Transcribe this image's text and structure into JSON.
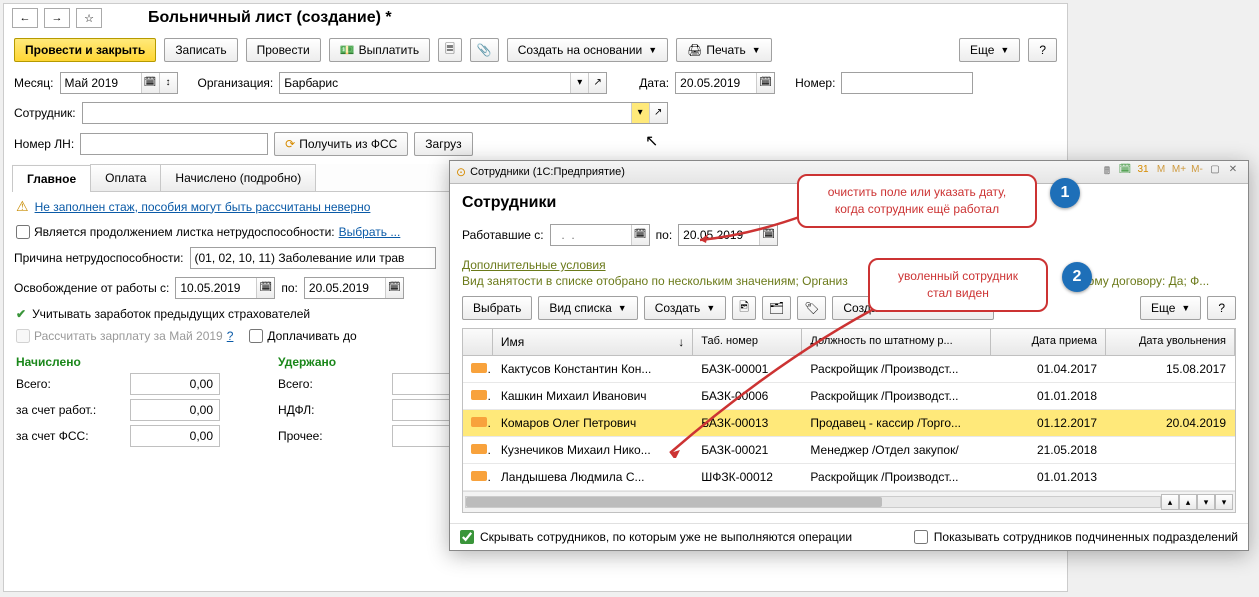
{
  "main": {
    "title": "Больничный лист (создание) *",
    "toolbar": {
      "submit": "Провести и закрыть",
      "save": "Записать",
      "post": "Провести",
      "payout": "Выплатить",
      "base": "Создать на основании",
      "print": "Печать",
      "more": "Еще",
      "help": "?"
    },
    "fields": {
      "month_lbl": "Месяц:",
      "month": "Май 2019",
      "org_lbl": "Организация:",
      "org": "Барбарис",
      "date_lbl": "Дата:",
      "date": "20.05.2019",
      "num_lbl": "Номер:",
      "emp_lbl": "Сотрудник:",
      "ln_lbl": "Номер ЛН:",
      "getfss": "Получить из ФСС",
      "load": "Загруз"
    },
    "tabs": {
      "main": "Главное",
      "pay": "Оплата",
      "acc": "Начислено (подробно)"
    },
    "warn": "Не заполнен стаж, пособия могут быть рассчитаны неверно",
    "cont_lbl": "Является продолжением листка нетрудоспособности:",
    "cont_link": "Выбрать ...",
    "cause_lbl": "Причина нетрудоспособности:",
    "cause_val": "(01, 02, 10, 11) Заболевание или трав",
    "free_lbl": "Освобождение от работы с:",
    "free_from": "10.05.2019",
    "free_to_lbl": "по:",
    "free_to": "20.05.2019",
    "prev_ins": "Учитывать заработок предыдущих страхователей",
    "recalc": "Рассчитать зарплату за Май 2019",
    "extra_lbl": "Доплачивать до",
    "totals": {
      "h1": "Начислено",
      "h2": "Удержано",
      "total_lbl": "Всего:",
      "emp_lbl": "за счет работ.:",
      "fss_lbl": "за счет ФСС:",
      "ndfl_lbl": "НДФЛ:",
      "other_lbl": "Прочее:",
      "zero": "0,00"
    }
  },
  "popup": {
    "title": "Сотрудники (1С:Предприятие)",
    "tb_icons": [
      "M",
      "M+",
      "M-"
    ],
    "h": "Сотрудники",
    "worked_lbl": "Работавшие с:",
    "worked_to_lbl": "по:",
    "worked_to": "20.05.2019",
    "more_cond": "Дополнительные условия",
    "filter_text": "Вид занятости в списке отобрано по нескольким значениям; Организ",
    "filter_text2": "довому договору: Да; Ф...",
    "btns": {
      "pick": "Выбрать",
      "view": "Вид списка",
      "create": "Создать",
      "base": "Создать на основании",
      "more": "Еще",
      "help": "?"
    },
    "cols": {
      "name": "Имя",
      "tab": "Таб. номер",
      "pos": "Должность по штатному р...",
      "hire": "Дата приема",
      "fire": "Дата увольнения"
    },
    "rows": [
      {
        "name": "Кактусов Константин Кон...",
        "tab": "БАЗК-00001",
        "pos": "Раскройщик /Производст...",
        "hire": "01.04.2017",
        "fire": "15.08.2017",
        "sel": false
      },
      {
        "name": "Кашкин Михаил Иванович",
        "tab": "БАЗК-00006",
        "pos": "Раскройщик /Производст...",
        "hire": "01.01.2018",
        "fire": "",
        "sel": false
      },
      {
        "name": "Комаров Олег Петрович",
        "tab": "БАЗК-00013",
        "pos": "Продавец - кассир /Торго...",
        "hire": "01.12.2017",
        "fire": "20.04.2019",
        "sel": true
      },
      {
        "name": "Кузнечиков Михаил Нико...",
        "tab": "БАЗК-00021",
        "pos": "Менеджер /Отдел закупок/",
        "hire": "21.05.2018",
        "fire": "",
        "sel": false
      },
      {
        "name": "Ландышева Людмила С...",
        "tab": "ШФЗК-00012",
        "pos": "Раскройщик /Производст...",
        "hire": "01.01.2013",
        "fire": "",
        "sel": false
      }
    ],
    "hide_fired": "Скрывать сотрудников, по которым уже не выполняются операции",
    "show_sub": "Показывать сотрудников подчиненных подразделений"
  },
  "callouts": {
    "c1a": "очистить поле или указать дату,",
    "c1b": "когда сотрудник ещё работал",
    "c2a": "уволенный сотрудник",
    "c2b": "стал виден"
  }
}
